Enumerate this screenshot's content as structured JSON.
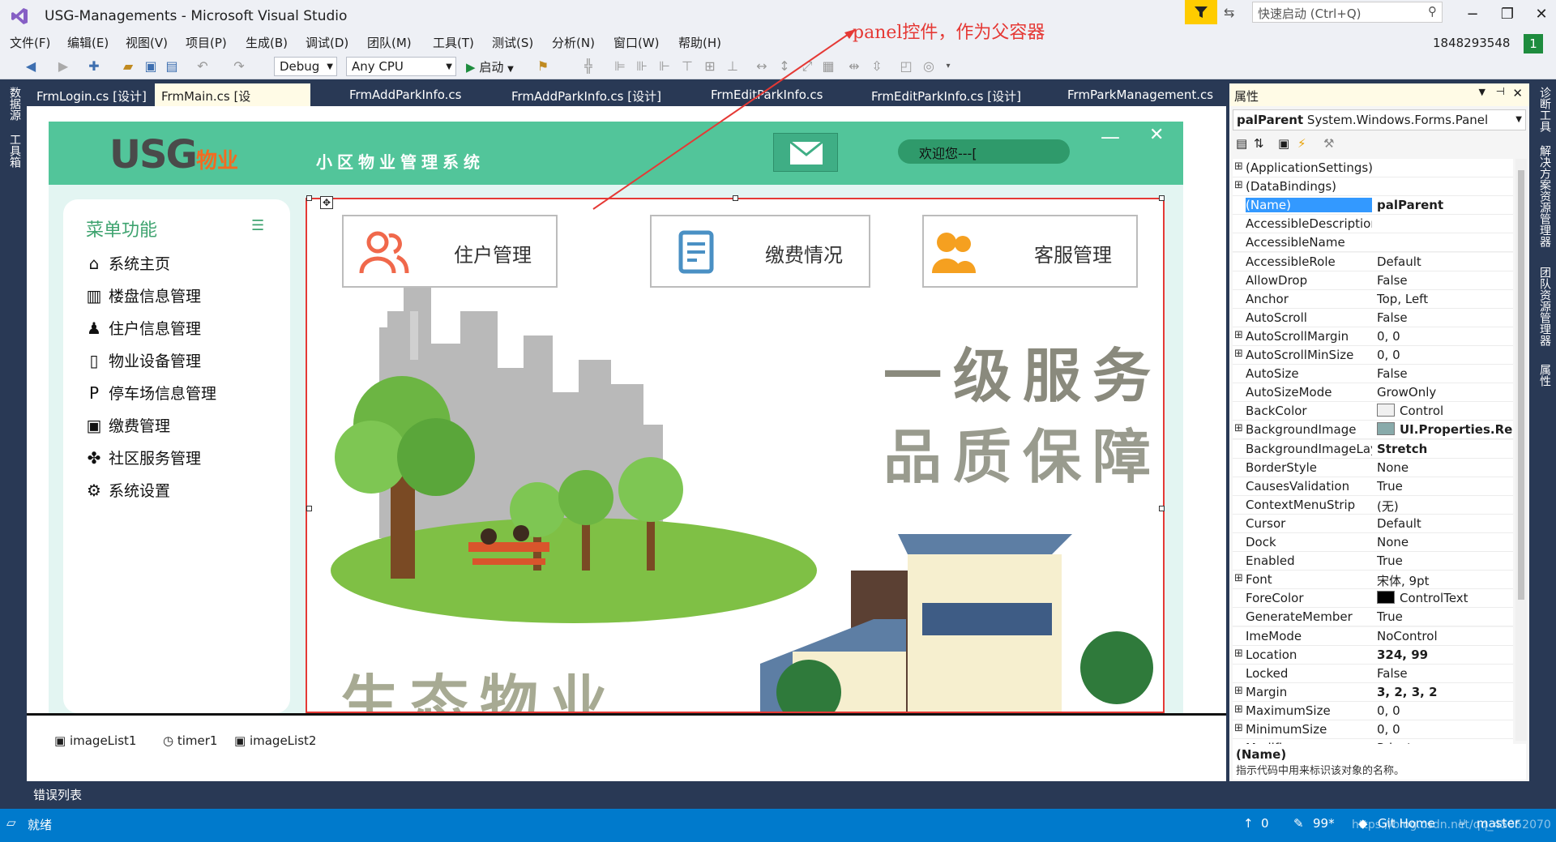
{
  "window": {
    "title": "USG-Managements - Microsoft Visual Studio",
    "quick_launch_placeholder": "快速启动 (Ctrl+Q)",
    "account": "1848293548",
    "account_badge": "1"
  },
  "menu": [
    "文件(F)",
    "编辑(E)",
    "视图(V)",
    "项目(P)",
    "生成(B)",
    "调试(D)",
    "团队(M)",
    "工具(T)",
    "测试(S)",
    "分析(N)",
    "窗口(W)",
    "帮助(H)"
  ],
  "toolbar": {
    "config": "Debug",
    "platform": "Any CPU",
    "start_label": "启动"
  },
  "left_strip": [
    "数据源",
    "工具箱"
  ],
  "right_strip": [
    "诊断工具",
    "解决方案资源管理器",
    "团队资源管理器",
    "属性"
  ],
  "doc_tabs": [
    {
      "label": "FrmLogin.cs [设计]",
      "active": false
    },
    {
      "label": "FrmMain.cs [设计]",
      "active": true
    },
    {
      "label": "FrmAddParkInfo.cs",
      "active": false
    },
    {
      "label": "FrmAddParkInfo.cs [设计]",
      "active": false
    },
    {
      "label": "FrmEditParkInfo.cs",
      "active": false
    },
    {
      "label": "FrmEditParkInfo.cs [设计]",
      "active": false
    },
    {
      "label": "FrmParkManagement.cs",
      "active": false
    }
  ],
  "form": {
    "logo_usg": "USG",
    "logo_wy": "物业",
    "system_name": "小区物业管理系统",
    "welcome": "欢迎您---[",
    "menu_title": "菜单功能",
    "nav_items": [
      {
        "label": "系统主页",
        "icon": "home-icon"
      },
      {
        "label": "楼盘信息管理",
        "icon": "building-icon"
      },
      {
        "label": "住户信息管理",
        "icon": "user-icon"
      },
      {
        "label": "物业设备管理",
        "icon": "device-icon"
      },
      {
        "label": "停车场信息管理",
        "icon": "parking-icon"
      },
      {
        "label": "缴费管理",
        "icon": "wallet-icon"
      },
      {
        "label": "社区服务管理",
        "icon": "clover-icon"
      },
      {
        "label": "系统设置",
        "icon": "settings-icon"
      }
    ],
    "buttons": [
      "住户管理",
      "缴费情况",
      "客服管理"
    ],
    "slogan_line1": "一级服务",
    "slogan_line2": "品质保障",
    "slogan_bottom": "生态物业"
  },
  "annotation": "panel控件，作为父容器",
  "tray": [
    "imageList1",
    "timer1",
    "imageList2"
  ],
  "properties": {
    "title": "属性",
    "object": "palParent",
    "object_type": "System.Windows.Forms.Panel",
    "rows": [
      {
        "name": "(ApplicationSettings)",
        "value": "",
        "expandable": true
      },
      {
        "name": "(DataBindings)",
        "value": "",
        "expandable": true
      },
      {
        "name": "(Name)",
        "value": "palParent",
        "bold": true,
        "selected": true
      },
      {
        "name": "AccessibleDescription",
        "value": ""
      },
      {
        "name": "AccessibleName",
        "value": ""
      },
      {
        "name": "AccessibleRole",
        "value": "Default"
      },
      {
        "name": "AllowDrop",
        "value": "False"
      },
      {
        "name": "Anchor",
        "value": "Top, Left"
      },
      {
        "name": "AutoScroll",
        "value": "False"
      },
      {
        "name": "AutoScrollMargin",
        "value": "0, 0",
        "expandable": true
      },
      {
        "name": "AutoScrollMinSize",
        "value": "0, 0",
        "expandable": true
      },
      {
        "name": "AutoSize",
        "value": "False"
      },
      {
        "name": "AutoSizeMode",
        "value": "GrowOnly"
      },
      {
        "name": "BackColor",
        "value": "Control",
        "swatch": "#f0f0f0"
      },
      {
        "name": "BackgroundImage",
        "value": "UI.Properties.Resc",
        "bold": true,
        "expandable": true,
        "swatch": "#8aa"
      },
      {
        "name": "BackgroundImageLayout",
        "value": "Stretch",
        "bold": true
      },
      {
        "name": "BorderStyle",
        "value": "None"
      },
      {
        "name": "CausesValidation",
        "value": "True"
      },
      {
        "name": "ContextMenuStrip",
        "value": "(无)"
      },
      {
        "name": "Cursor",
        "value": "Default"
      },
      {
        "name": "Dock",
        "value": "None"
      },
      {
        "name": "Enabled",
        "value": "True"
      },
      {
        "name": "Font",
        "value": "宋体, 9pt",
        "expandable": true
      },
      {
        "name": "ForeColor",
        "value": "ControlText",
        "swatch": "#000000"
      },
      {
        "name": "GenerateMember",
        "value": "True"
      },
      {
        "name": "ImeMode",
        "value": "NoControl"
      },
      {
        "name": "Location",
        "value": "324, 99",
        "bold": true,
        "expandable": true
      },
      {
        "name": "Locked",
        "value": "False"
      },
      {
        "name": "Margin",
        "value": "3, 2, 3, 2",
        "bold": true,
        "expandable": true
      },
      {
        "name": "MaximumSize",
        "value": "0, 0",
        "expandable": true
      },
      {
        "name": "MinimumSize",
        "value": "0, 0",
        "expandable": true
      },
      {
        "name": "Modifiers",
        "value": "Private"
      }
    ],
    "desc_title": "(Name)",
    "desc_text": "指示代码中用来标识该对象的名称。"
  },
  "error_list": "错误列表",
  "status": {
    "ready": "就绪",
    "up": "0",
    "edits": "99*",
    "repo": "Git Home",
    "branch": "master",
    "watermark": "https://blog.csdn.net/qq_45052070"
  }
}
